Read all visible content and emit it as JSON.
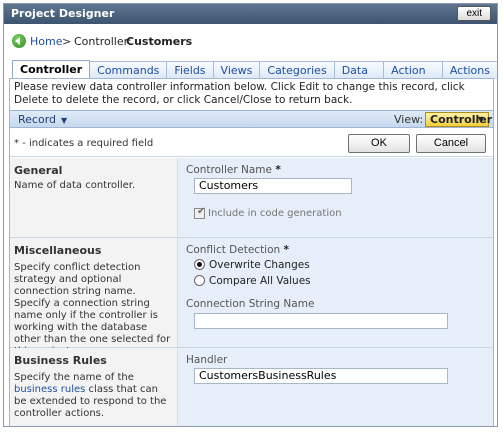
{
  "window": {
    "title": "Project Designer",
    "exit_label": "exit"
  },
  "breadcrumb": {
    "home": "Home",
    "separator": ">",
    "controller_prefix": "Controller:",
    "controller_name": "Customers"
  },
  "tabs": [
    "Controller",
    "Commands",
    "Fields",
    "Views",
    "Categories",
    "Data Fields",
    "Action Groups",
    "Actions"
  ],
  "description": "Please review data controller information below. Click Edit to change this record, click Delete to delete the record, or click Cancel/Close to return back.",
  "toolbar": {
    "record_menu": "Record",
    "view_label": "View:",
    "view_value": "Controller"
  },
  "form": {
    "required_note": "* - indicates a required field",
    "ok_label": "OK",
    "cancel_label": "Cancel"
  },
  "sections": {
    "general": {
      "title": "General",
      "description": "Name of data controller.",
      "controller_name_label": "Controller Name",
      "controller_name_value": "Customers",
      "include_label": "Include in code generation",
      "include_checked": true
    },
    "misc": {
      "title": "Miscellaneous",
      "description": "Specify conflict detection strategy and optional connection string name. Specify a connection string name only if the controller is working with the database other than the one selected for this project.",
      "conflict_label": "Conflict Detection",
      "option_overwrite": "Overwrite Changes",
      "option_compare": "Compare All Values",
      "selected": "Overwrite Changes",
      "connection_label": "Connection String Name",
      "connection_value": ""
    },
    "rules": {
      "title": "Business Rules",
      "desc_pre": "Specify the name of the",
      "desc_link": "business rules",
      "desc_post": "class that can be extended to respond to the controller actions.",
      "handler_label": "Handler",
      "handler_value": "CustomersBusinessRules"
    }
  },
  "required_marker": "*"
}
